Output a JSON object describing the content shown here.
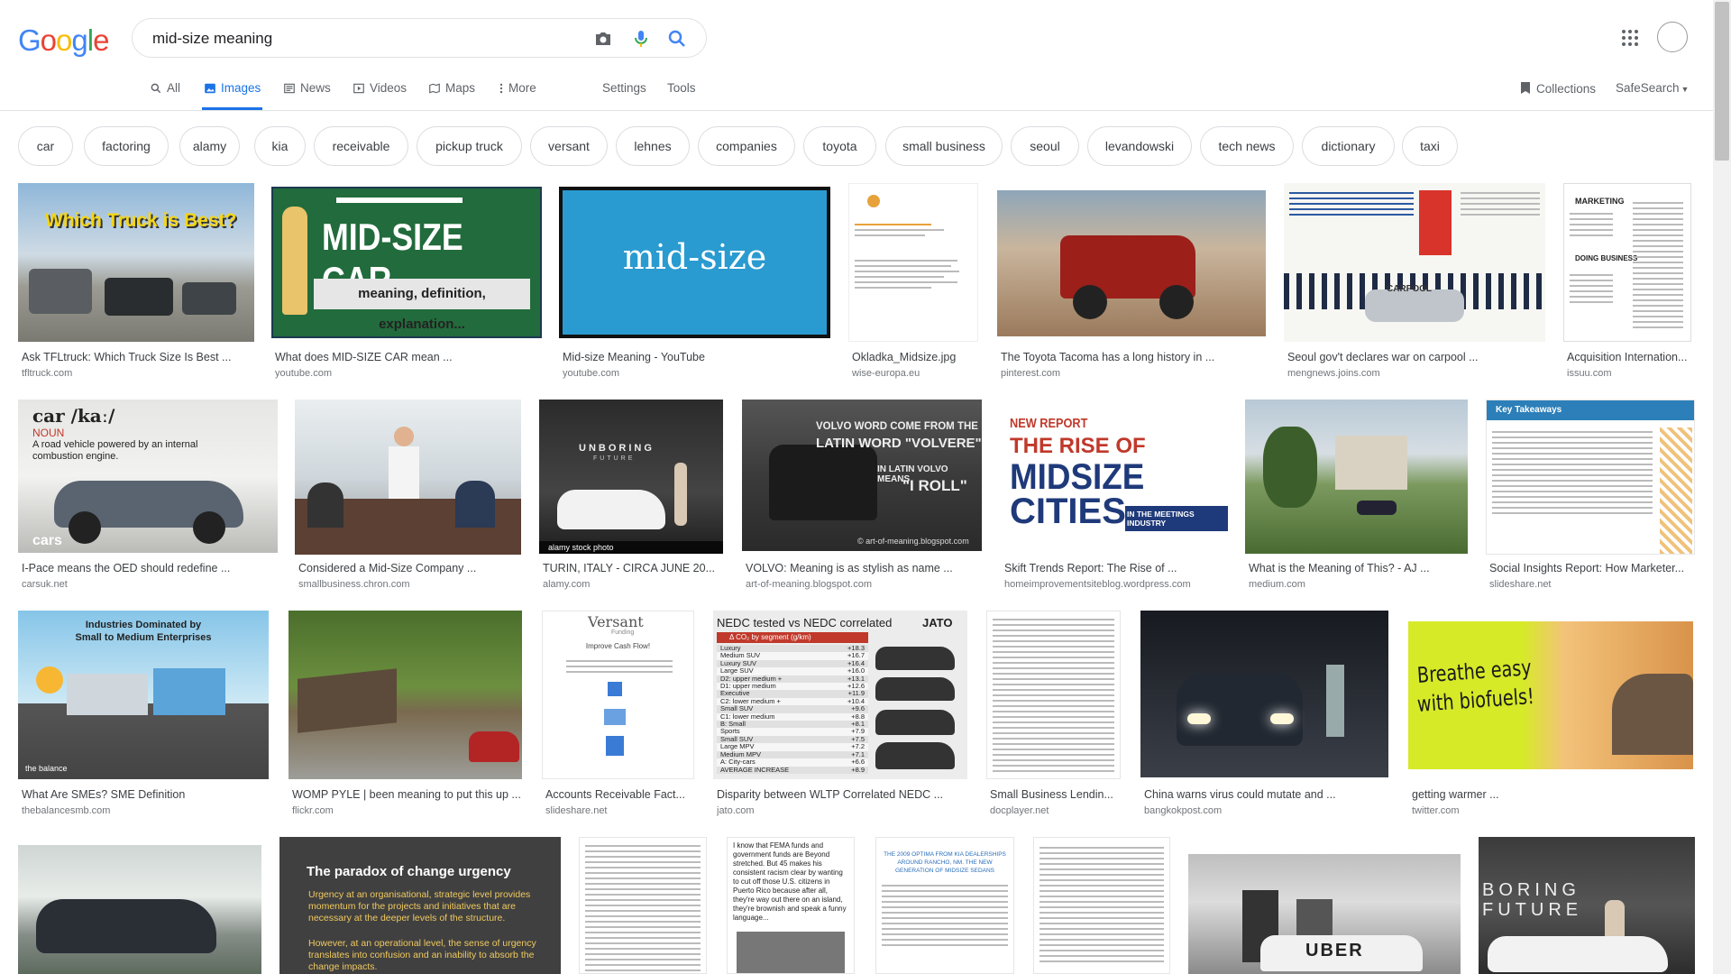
{
  "search": {
    "query": "mid-size meaning"
  },
  "logo": {
    "text": "Google"
  },
  "tabs": [
    {
      "label": "All"
    },
    {
      "label": "Images"
    },
    {
      "label": "News"
    },
    {
      "label": "Videos"
    },
    {
      "label": "Maps"
    },
    {
      "label": "More"
    },
    {
      "label": "Settings"
    },
    {
      "label": "Tools"
    }
  ],
  "right": {
    "collections": "Collections",
    "safesearch": "SafeSearch"
  },
  "chips": [
    "car",
    "factoring",
    "alamy",
    "kia",
    "receivable",
    "pickup truck",
    "versant",
    "lehnes",
    "companies",
    "toyota",
    "small business",
    "seoul",
    "levandowski",
    "tech news",
    "dictionary",
    "taxi"
  ],
  "thumb_text": {
    "t1": "Which Truck is Best?",
    "t2a": "MID-SIZE CAR",
    "t2b": "meaning, definition, explanation...",
    "t3": "mid-size",
    "t7": "MARKETING",
    "t7b": "DOING BUSINESS",
    "t6": "CARPOOL",
    "t8a": "car /kaː/",
    "t8b": "NOUN",
    "t8c": "A road vehicle powered by an internal combustion engine.",
    "t8d": "cars",
    "t10a": "UNBORING",
    "t10b": "FUTURE",
    "t10c": "alamy stock photo",
    "t11a": "VOLVO WORD COME FROM THE",
    "t11b": "LATIN WORD \"VOLVERE\"",
    "t11c": "IN LATIN VOLVO MEANS",
    "t11d": "\"I ROLL\"",
    "t11e": "© art-of-meaning.blogspot.com",
    "t12a": "NEW REPORT",
    "t12b": "THE RISE OF",
    "t12c": "MIDSIZE",
    "t12d": "CITIES",
    "t12e": "IN THE MEETINGS INDUSTRY",
    "t14": "Key Takeaways",
    "t15a": "Industries Dominated by",
    "t15b": "Small to Medium Enterprises",
    "t15c": "the balance",
    "t17a": "Versant",
    "t17b": "Funding",
    "t17c": "Improve Cash Flow!",
    "t18a": "NEDC tested vs NEDC correlated",
    "t18b": "JATO",
    "t18c": "Δ CO₂ by segment (g/km)",
    "t21a": "Breathe easy",
    "t21b": "with biofuels!",
    "t23a": "The paradox of change urgency",
    "t23b": "Urgency at an organisational, strategic level provides momentum for the projects and initiatives that are necessary at the deeper levels of the structure.",
    "t23c": "However, at an operational level, the sense of urgency translates into confusion and an inability to absorb the change impacts.",
    "t25": "I know that FEMA funds and government funds are Beyond stretched. But 45 makes his consistent racism clear by wanting to cut off those U.S. citizens in Puerto Rico because after all, they're way out there on an island, they're brownish and speak a funny language...",
    "t26": "THE 2009 OPTIMA FROM KIA DEALERSHIPS AROUND RANCHO, NM. THE NEW GENERATION OF MIDSIZE SEDANS",
    "t28": "UBER",
    "t29": "BORING FUTURE"
  },
  "nedc_rows": [
    [
      "Luxury",
      "+18.3"
    ],
    [
      "Medium SUV",
      "+16.7"
    ],
    [
      "Luxury SUV",
      "+16.4"
    ],
    [
      "Large SUV",
      "+16.0"
    ],
    [
      "D2: upper medium +",
      "+13.1"
    ],
    [
      "D1: upper medium",
      "+12.6"
    ],
    [
      "Executive",
      "+11.9"
    ],
    [
      "C2: lower medium +",
      "+10.4"
    ],
    [
      "Small SUV",
      "+9.6"
    ],
    [
      "C1: lower medium",
      "+8.8"
    ],
    [
      "B: Small",
      "+8.1"
    ],
    [
      "Sports",
      "+7.9"
    ],
    [
      "Small SUV",
      "+7.5"
    ],
    [
      "Large MPV",
      "+7.2"
    ],
    [
      "Medium MPV",
      "+7.1"
    ],
    [
      "A: City-cars",
      "+6.6"
    ],
    [
      "AVERAGE INCREASE",
      "+8.9"
    ]
  ],
  "results": [
    {
      "caption": "Ask TFLtruck: Which Truck Size Is Best ...",
      "source": "tfltruck.com"
    },
    {
      "caption": "What does MID-SIZE CAR mean ...",
      "source": "youtube.com"
    },
    {
      "caption": "Mid-size Meaning - YouTube",
      "source": "youtube.com"
    },
    {
      "caption": "Okladka_Midsize.jpg",
      "source": "wise-europa.eu"
    },
    {
      "caption": "The Toyota Tacoma has a long history in ...",
      "source": "pinterest.com"
    },
    {
      "caption": "Seoul gov't declares war on carpool ...",
      "source": "mengnews.joins.com"
    },
    {
      "caption": "Acquisition Internation...",
      "source": "issuu.com"
    },
    {
      "caption": "I-Pace means the OED should redefine ...",
      "source": "carsuk.net"
    },
    {
      "caption": "Considered a Mid-Size Company ...",
      "source": "smallbusiness.chron.com"
    },
    {
      "caption": "TURIN, ITALY - CIRCA JUNE 20...",
      "source": "alamy.com"
    },
    {
      "caption": "VOLVO: Meaning is as stylish as name ...",
      "source": "art-of-meaning.blogspot.com"
    },
    {
      "caption": "Skift Trends Report: The Rise of ...",
      "source": "homeimprovementsiteblog.wordpress.com"
    },
    {
      "caption": "What is the Meaning of This? - AJ ...",
      "source": "medium.com"
    },
    {
      "caption": "Social Insights Report: How Marketer...",
      "source": "slideshare.net"
    },
    {
      "caption": "What Are SMEs? SME Definition",
      "source": "thebalancesmb.com"
    },
    {
      "caption": "WOMP PYLE | been meaning to put this up ...",
      "source": "flickr.com"
    },
    {
      "caption": "Accounts Receivable Fact...",
      "source": "slideshare.net"
    },
    {
      "caption": "Disparity between WLTP Correlated NEDC ...",
      "source": "jato.com"
    },
    {
      "caption": "Small Business Lendin...",
      "source": "docplayer.net"
    },
    {
      "caption": "China warns virus could mutate and ...",
      "source": "bangkokpost.com"
    },
    {
      "caption": "getting warmer ...",
      "source": "twitter.com"
    }
  ]
}
